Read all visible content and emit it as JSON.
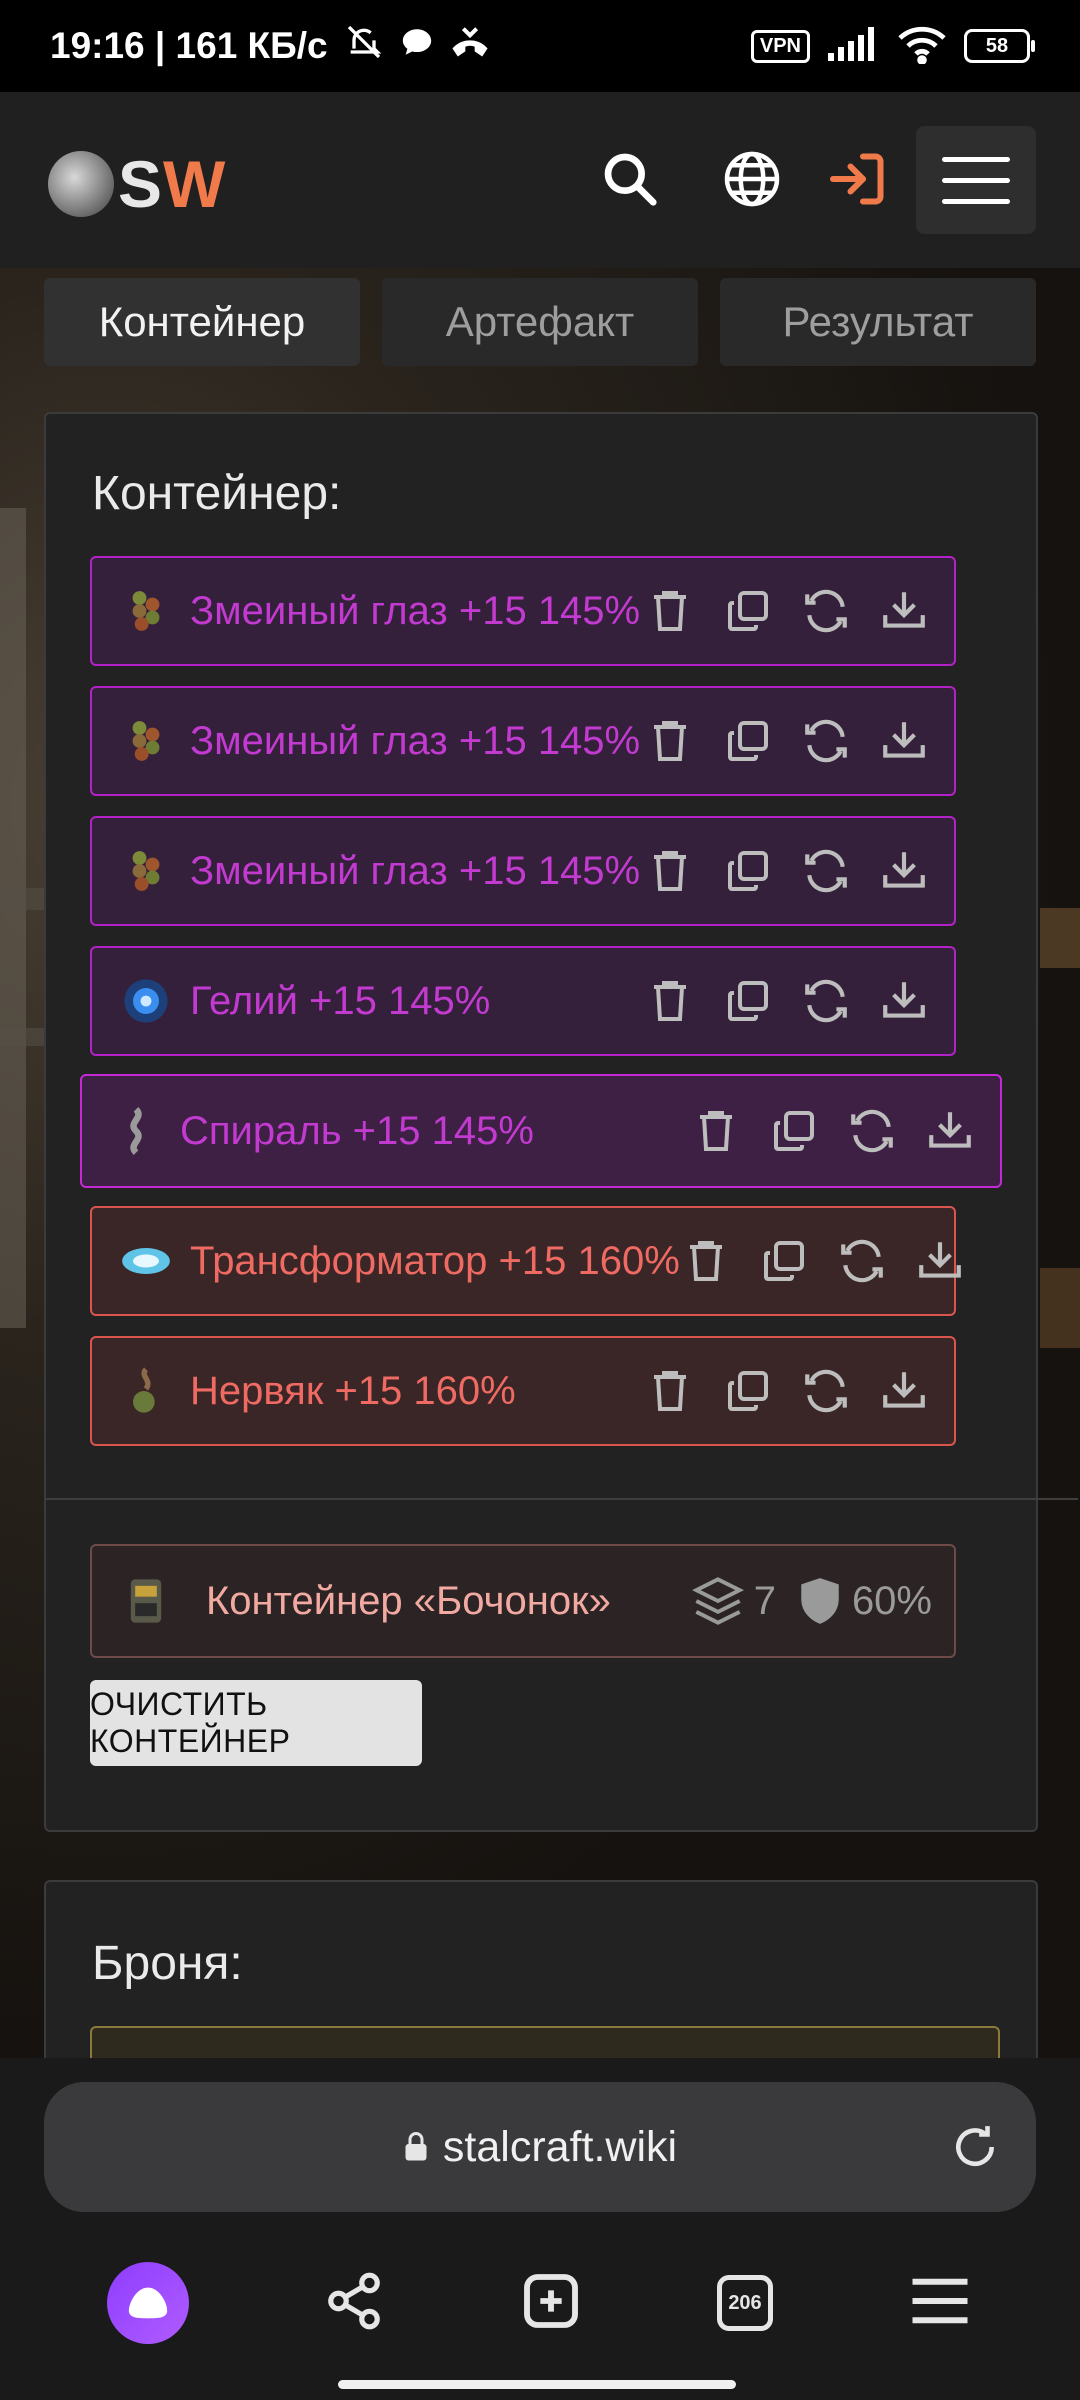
{
  "status_bar": {
    "time_speed": "19:16 | 161 КБ/с",
    "vpn": "VPN",
    "battery": "58"
  },
  "header": {
    "logo_s": "S",
    "logo_w": "W",
    "icons": [
      "search-icon",
      "globe-icon",
      "login-icon",
      "menu-icon"
    ],
    "accent_color": "#f07a4a"
  },
  "tabs": [
    {
      "label": "Контейнер",
      "active": true
    },
    {
      "label": "Артефакт",
      "active": false
    },
    {
      "label": "Результат",
      "active": false
    }
  ],
  "container_panel": {
    "title": "Контейнер:",
    "artifacts": [
      {
        "name": "Змеиный глаз +15 145%",
        "rarity": "purple"
      },
      {
        "name": "Змеиный глаз +15 145%",
        "rarity": "purple"
      },
      {
        "name": "Змеиный глаз +15 145%",
        "rarity": "purple"
      },
      {
        "name": "Гелий +15 145%",
        "rarity": "purple"
      },
      {
        "name": "Спираль +15 145%",
        "rarity": "purple"
      },
      {
        "name": "Трансформатор +15 160%",
        "rarity": "red"
      },
      {
        "name": "Нервяк +15 160%",
        "rarity": "red"
      }
    ],
    "container": {
      "name": "Контейнер «Бочонок»",
      "slots": "7",
      "protection": "60%"
    },
    "clear_button": "ОЧИСТИТЬ КОНТЕЙНЕР"
  },
  "armor_panel": {
    "title": "Броня:"
  },
  "browser": {
    "url": "stalcraft.wiki",
    "tabs_count": "206"
  }
}
